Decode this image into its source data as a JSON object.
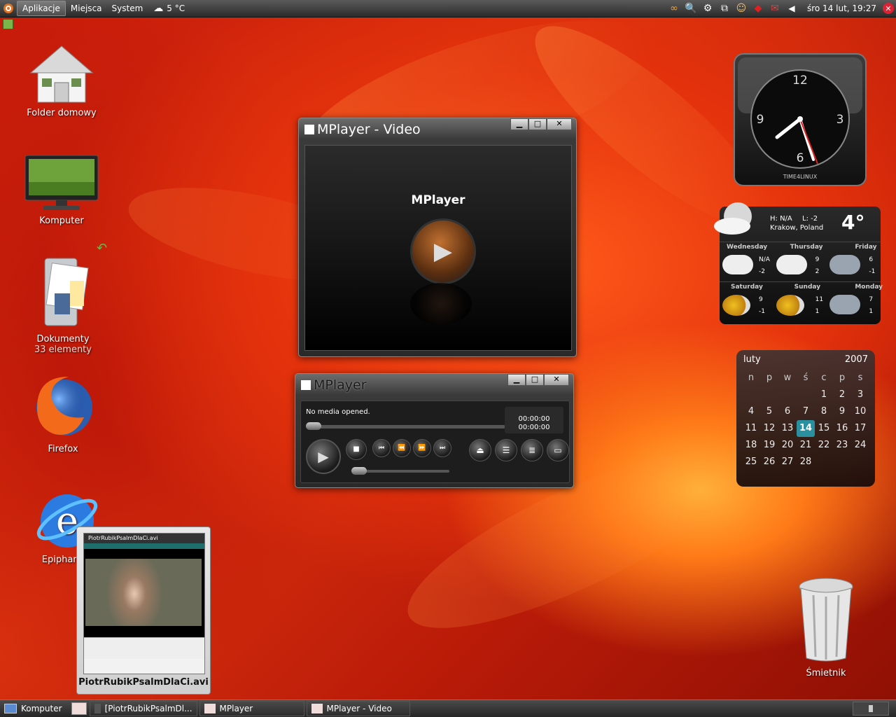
{
  "top_panel": {
    "menus": [
      "Aplikacje",
      "Miejsca",
      "System"
    ],
    "weather_temp": "5 °C",
    "clock": "śro 14 lut, 19:27"
  },
  "desktop_icons": [
    {
      "label": "Folder domowy",
      "sub": ""
    },
    {
      "label": "Komputer",
      "sub": ""
    },
    {
      "label": "Dokumenty",
      "sub": "33 elementy"
    },
    {
      "label": "Firefox",
      "sub": ""
    },
    {
      "label": "Epiphany",
      "sub": ""
    },
    {
      "label": "Śmietnik",
      "sub": ""
    }
  ],
  "video_window": {
    "title": "MPlayer - Video",
    "logo_text": "MPlayer"
  },
  "player_window": {
    "title": "MPlayer",
    "status": "No media opened.",
    "time_elapsed": "00:00:00",
    "time_total": "00:00:00"
  },
  "thumbnail": {
    "title": "PiotrRubikPsalmDlaCi.avi",
    "caption": "PiotrRubikPsalmDlaCi.avi"
  },
  "clock_gadget": {
    "numbers": [
      "12",
      "3",
      "6",
      "9"
    ],
    "brand": "TIME4LINUX"
  },
  "weather_gadget": {
    "hi": "H: N/A",
    "lo": "L: -2",
    "location": "Krakow, Poland",
    "temp": "4°",
    "days": [
      {
        "name": "Wednesday",
        "hi": "N/A",
        "lo": "-2"
      },
      {
        "name": "Thursday",
        "hi": "9",
        "lo": "2"
      },
      {
        "name": "Friday",
        "hi": "6",
        "lo": "-1"
      },
      {
        "name": "Saturday",
        "hi": "9",
        "lo": "-1"
      },
      {
        "name": "Sunday",
        "hi": "11",
        "lo": "1"
      },
      {
        "name": "Monday",
        "hi": "7",
        "lo": "1"
      }
    ]
  },
  "calendar": {
    "month": "luty",
    "year": "2007",
    "weekdays": [
      "n",
      "p",
      "w",
      "ś",
      "c",
      "p",
      "s"
    ],
    "today": "14",
    "cells": [
      "",
      "",
      "",
      "",
      "1",
      "2",
      "3",
      "4",
      "5",
      "6",
      "7",
      "8",
      "9",
      "10",
      "11",
      "12",
      "13",
      "14",
      "15",
      "16",
      "17",
      "18",
      "19",
      "20",
      "21",
      "22",
      "23",
      "24",
      "25",
      "26",
      "27",
      "28",
      "",
      "",
      ""
    ]
  },
  "taskbar": {
    "show_desktop": "Komputer",
    "tasks": [
      "[PiotrRubikPsalmDl...",
      "MPlayer",
      "MPlayer - Video"
    ]
  }
}
